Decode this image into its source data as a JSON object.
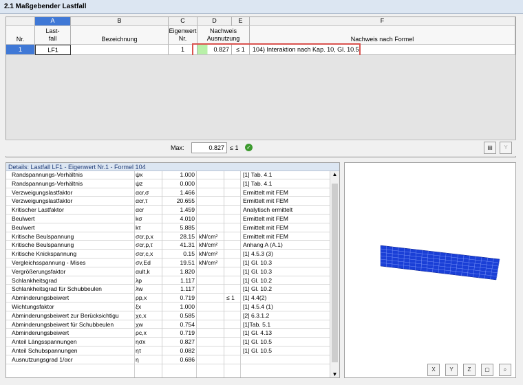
{
  "window": {
    "title": "2.1 Maßgebender Lastfall"
  },
  "columns": {
    "letters": [
      "A",
      "B",
      "C",
      "D",
      "E",
      "F"
    ],
    "nr": "Nr.",
    "lastfall": "Last-\nfall",
    "bezeichnung": "Bezeichnung",
    "eigenwert": "Eigenwert\nNr.",
    "nachweis": "Nachweis\nAusnutzung",
    "formel": "Nachweis nach Formel"
  },
  "row": {
    "nr": "1",
    "lastfall": "LF1",
    "bezeichnung": "",
    "eigenwert": "1",
    "ausnutzung": "0.827",
    "le": "≤ 1",
    "formel": "104) Interaktion nach Kap. 10, Gl. 10.5"
  },
  "max": {
    "label": "Max:",
    "value": "0.827",
    "le": "≤ 1"
  },
  "details": {
    "title": "Details: Lastfall LF1 - Eigenwert Nr.1 - Formel 104",
    "rows": [
      [
        "Randspannungs-Verhältnis",
        "ψx",
        "1.000",
        "",
        "",
        "[1] Tab. 4.1"
      ],
      [
        "Randspannungs-Verhältnis",
        "ψz",
        "0.000",
        "",
        "",
        "[1] Tab. 4.1"
      ],
      [
        "Verzweigungslastfaktor",
        "αcr,σ",
        "1.466",
        "",
        "",
        "Ermittelt mit FEM"
      ],
      [
        "Verzweigungslastfaktor",
        "αcr,τ",
        "20.655",
        "",
        "",
        "Ermittelt mit FEM"
      ],
      [
        "Kritischer Lastfaktor",
        "αcr",
        "1.459",
        "",
        "",
        "Analytisch ermittelt"
      ],
      [
        "Beulwert",
        "kσ",
        "4.010",
        "",
        "",
        "Ermittelt mit FEM"
      ],
      [
        "Beulwert",
        "kτ",
        "5.885",
        "",
        "",
        "Ermittelt mit FEM"
      ],
      [
        "Kritische Beulspannung",
        "σcr,p,x",
        "28.15",
        "kN/cm²",
        "",
        "Ermittelt mit FEM"
      ],
      [
        "Kritische Beulspannung",
        "σcr,p,τ",
        "41.31",
        "kN/cm²",
        "",
        "Anhang A (A.1)"
      ],
      [
        "Kritische Knickspannung",
        "σcr,c,x",
        "0.15",
        "kN/cm²",
        "",
        "[1] 4.5.3 (3)"
      ],
      [
        "Vergleichsspannung - Mises",
        "σv,Ed",
        "19.51",
        "kN/cm²",
        "",
        "[1] Gl. 10.3"
      ],
      [
        "Vergrößerungsfaktor",
        "αult,k",
        "1.820",
        "",
        "",
        "[1] Gl. 10.3"
      ],
      [
        "Schlankheitsgrad",
        "λp",
        "1.117",
        "",
        "",
        "[1] Gl. 10.2"
      ],
      [
        "Schlankheitsgrad für Schubbeulen",
        "λw",
        "1.117",
        "",
        "",
        "[1] Gl. 10.2"
      ],
      [
        "Abminderungsbeiwert",
        "ρp,x",
        "0.719",
        "",
        "≤ 1",
        "[1] 4.4(2)"
      ],
      [
        "Wichtungsfaktor",
        "ξx",
        "1.000",
        "",
        "",
        "[1] 4.5.4 (1)"
      ],
      [
        "Abminderungsbeiwert zur Berücksichtigu",
        "χc,x",
        "0.585",
        "",
        "",
        "[2] 6.3.1.2"
      ],
      [
        "Abminderungsbeiwert für Schubbeulen",
        "χw",
        "0.754",
        "",
        "",
        "[1]Tab. 5.1"
      ],
      [
        "Abminderungsbeiwert",
        "ρc,x",
        "0.719",
        "",
        "",
        "[1] Gl. 4.13"
      ],
      [
        "Anteil Längsspannungen",
        "ησx",
        "0.827",
        "",
        "",
        "[1] Gl. 10.5"
      ],
      [
        "Anteil Schubspannungen",
        "ητ",
        "0.082",
        "",
        "",
        "[1] Gl. 10.5"
      ],
      [
        "Ausnutzungsgrad 1/αcr",
        "η",
        "0.686",
        "",
        "",
        ""
      ]
    ]
  },
  "icons": {
    "ok": "ok-icon",
    "filter": "filter-icon",
    "view": [
      "view-x-icon",
      "view-y-icon",
      "view-z-icon",
      "view-iso-icon",
      "zoom-icon"
    ]
  },
  "colors": {
    "header": "#dce6f2",
    "selected": "#3f78d6",
    "highlight": "#d9534f",
    "mesh": "#1a3fd6"
  }
}
